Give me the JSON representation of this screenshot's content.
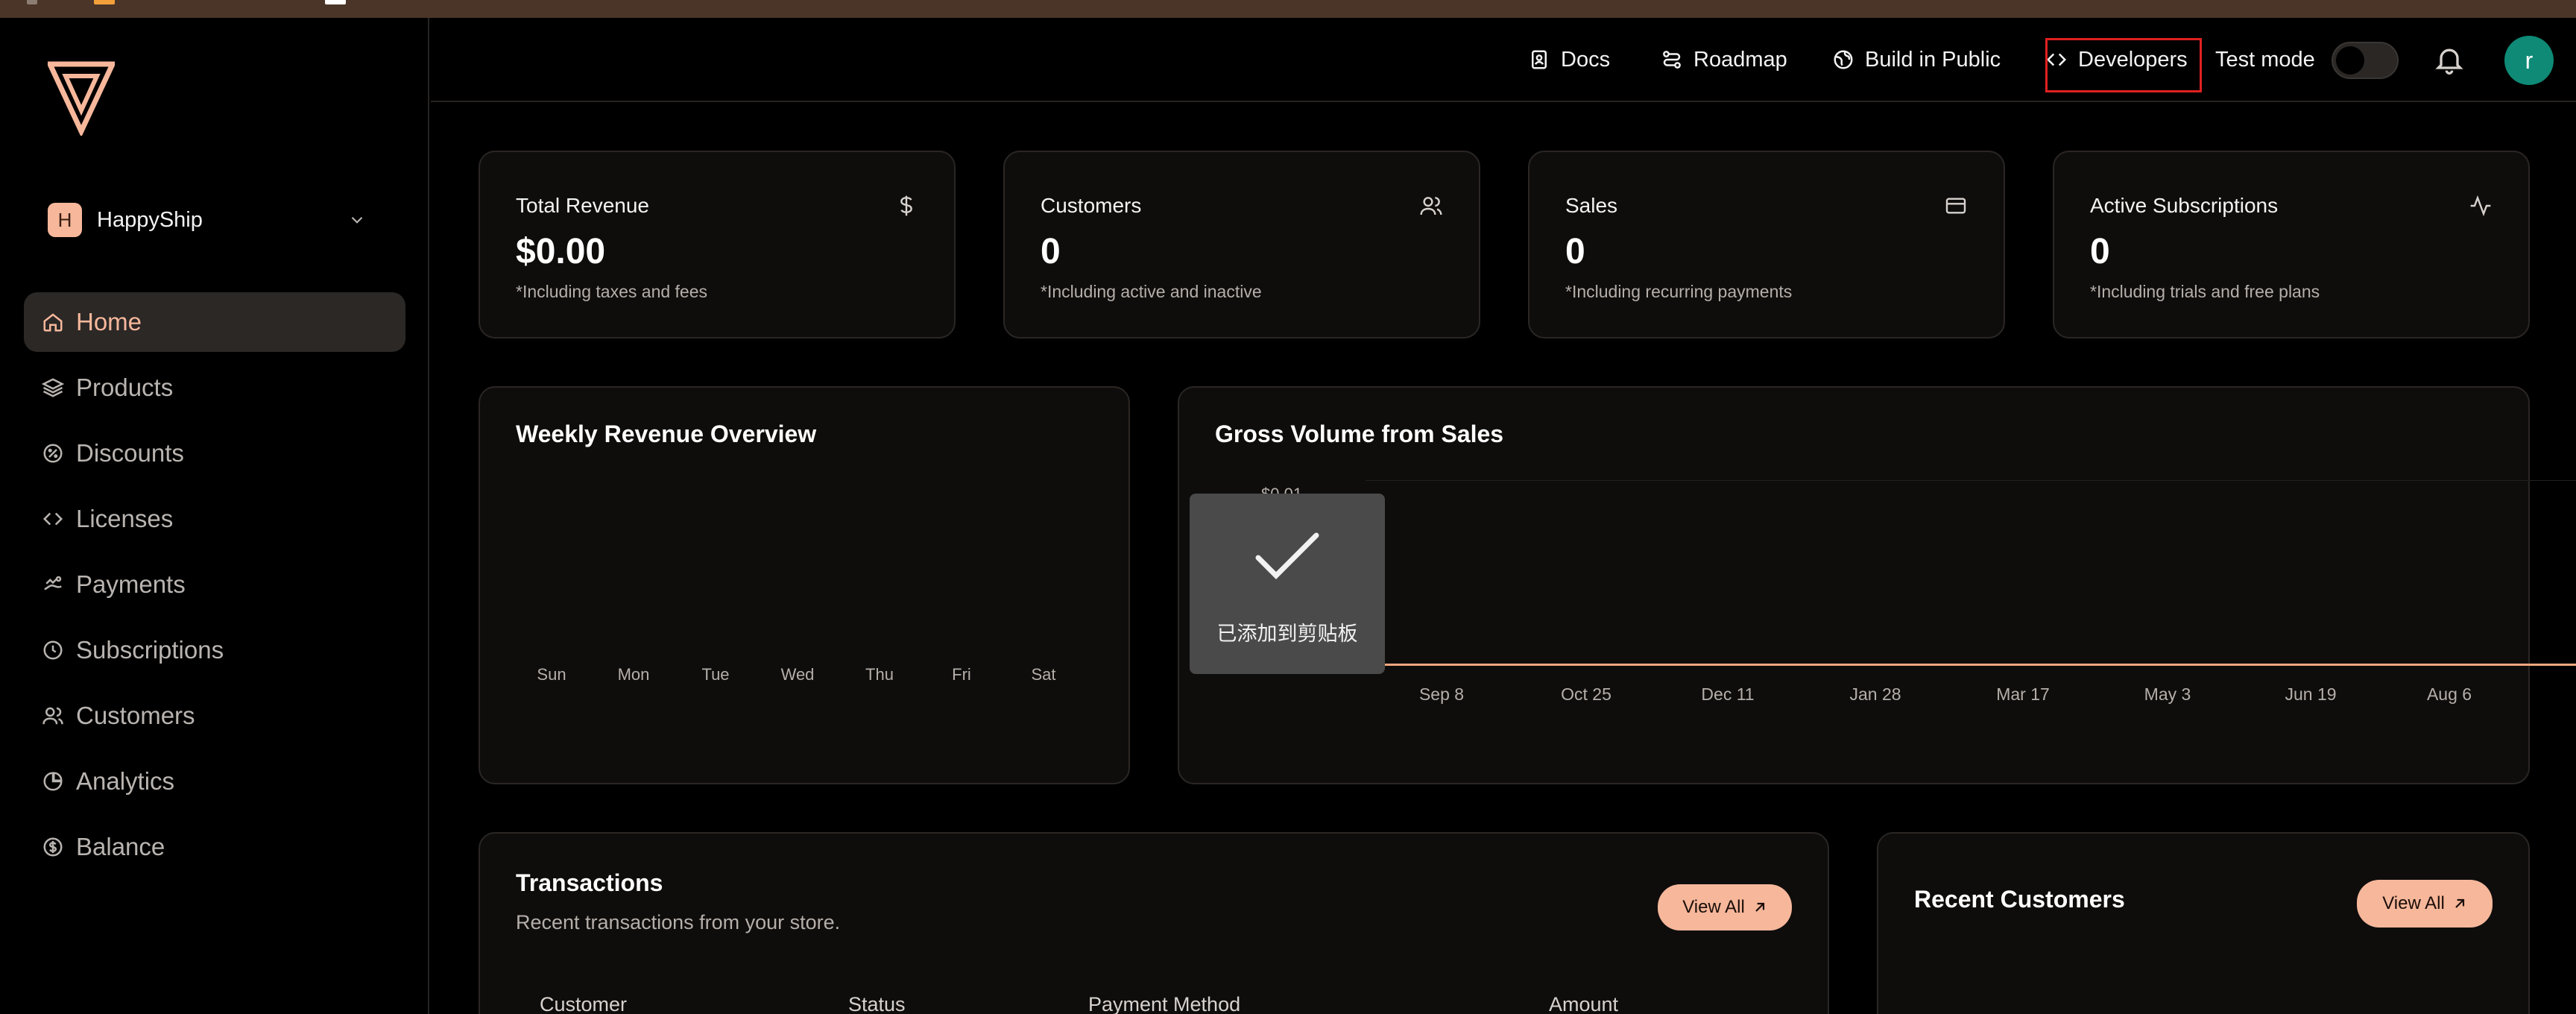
{
  "workspace": {
    "initial": "H",
    "name": "HappyShip"
  },
  "sidebar": {
    "items": [
      {
        "label": "Home",
        "icon": "home-icon",
        "active": true
      },
      {
        "label": "Products",
        "icon": "layers-icon"
      },
      {
        "label": "Discounts",
        "icon": "discount-icon"
      },
      {
        "label": "Licenses",
        "icon": "code-icon"
      },
      {
        "label": "Payments",
        "icon": "payments-icon"
      },
      {
        "label": "Subscriptions",
        "icon": "clock-icon"
      },
      {
        "label": "Customers",
        "icon": "users-icon"
      },
      {
        "label": "Analytics",
        "icon": "pie-chart-icon"
      },
      {
        "label": "Balance",
        "icon": "dollar-circle-icon"
      }
    ]
  },
  "topbar": {
    "docs": "Docs",
    "roadmap": "Roadmap",
    "build_in_public": "Build in Public",
    "developers": "Developers",
    "test_mode": "Test mode",
    "test_mode_on": false,
    "user_initial": "r"
  },
  "stats": [
    {
      "label": "Total Revenue",
      "value": "$0.00",
      "sub": "*Including taxes and fees",
      "icon": "dollar-icon"
    },
    {
      "label": "Customers",
      "value": "0",
      "sub": "*Including active and inactive",
      "icon": "users-icon"
    },
    {
      "label": "Sales",
      "value": "0",
      "sub": "*Including recurring payments",
      "icon": "credit-card-icon"
    },
    {
      "label": "Active Subscriptions",
      "value": "0",
      "sub": "*Including trials and free plans",
      "icon": "activity-icon"
    }
  ],
  "weekly": {
    "title": "Weekly Revenue Overview",
    "days": [
      "Sun",
      "Mon",
      "Tue",
      "Wed",
      "Thu",
      "Fri",
      "Sat"
    ]
  },
  "gross": {
    "title": "Gross Volume from Sales",
    "y_label": "$0.01",
    "x_labels": [
      "Sep 8",
      "Oct 25",
      "Dec 11",
      "Jan 28",
      "Mar 17",
      "May 3",
      "Jun 19",
      "Aug 6"
    ]
  },
  "toast": {
    "message": "已添加到剪贴板"
  },
  "transactions": {
    "title": "Transactions",
    "subtitle": "Recent transactions from your store.",
    "view_all": "View All",
    "columns": [
      "Customer",
      "Status",
      "Payment Method",
      "Amount"
    ]
  },
  "recent_customers": {
    "title": "Recent Customers",
    "view_all": "View All"
  },
  "colors": {
    "accent": "#f6b79b",
    "chart_line": "#f2a77e",
    "avatar": "#0e8a76",
    "highlight": "#e02020"
  }
}
